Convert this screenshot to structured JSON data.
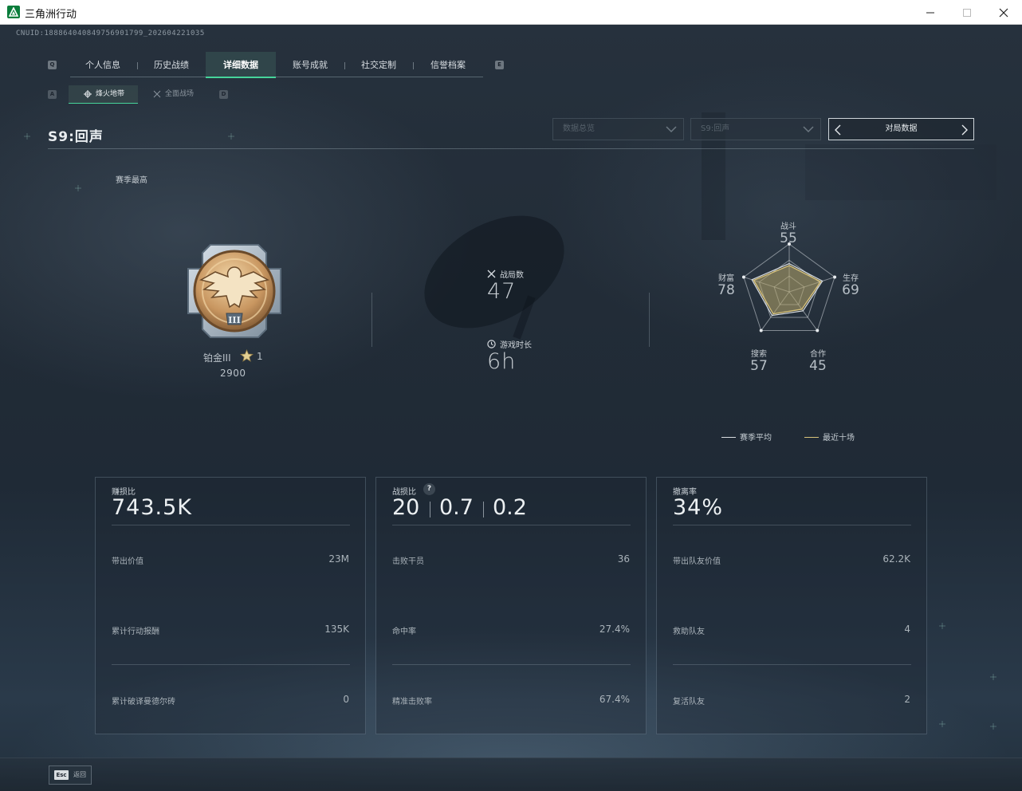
{
  "window": {
    "title": "三角洲行动"
  },
  "uid": "CNUID:1888640408497569017​99_202604221035",
  "nav": {
    "left_key": "Q",
    "right_key": "E",
    "tabs": [
      {
        "label": "个人信息",
        "active": false
      },
      {
        "label": "历史战绩",
        "active": false
      },
      {
        "label": "详细数据",
        "active": true
      },
      {
        "label": "账号成就",
        "active": false
      },
      {
        "label": "社交定制",
        "active": false
      },
      {
        "label": "信誉档案",
        "active": false
      }
    ]
  },
  "subnav": {
    "left_key": "A",
    "right_key": "D",
    "tabs": [
      {
        "label": "烽火地带",
        "active": true
      },
      {
        "label": "全面战场",
        "active": false
      }
    ]
  },
  "season_title": "S9:回声",
  "filters": {
    "data_scope": "数据总览",
    "season": "S9:回声",
    "match_data_button": "对局数据"
  },
  "rank": {
    "section_label": "赛季最高",
    "tier": "铂金III",
    "stars": "1",
    "score": "2900",
    "badge_icon": "platinum-eagle-badge-icon",
    "badge_numeral": "III"
  },
  "overview": {
    "matches_label": "战局数",
    "matches_value": "47",
    "playtime_label": "游戏时长",
    "playtime_value": "6h"
  },
  "radar": {
    "axes": [
      {
        "label": "战斗",
        "value": 55
      },
      {
        "label": "生存",
        "value": 69
      },
      {
        "label": "合作",
        "value": 45
      },
      {
        "label": "搜索",
        "value": 57
      },
      {
        "label": "财富",
        "value": 78
      }
    ],
    "legend": {
      "season_avg": "赛季平均",
      "recent_ten": "最近十场"
    },
    "colors": {
      "season_avg": "#d9dde0",
      "recent_ten": "#d8c27a",
      "fill": "#b7a66a"
    }
  },
  "cards": [
    {
      "title": "赚损比",
      "big_value": "743.5K",
      "rows": [
        {
          "label": "带出价值",
          "value": "23M"
        },
        {
          "label": "累计行动报酬",
          "value": "135K"
        },
        {
          "label": "累计破译曼德尔砖",
          "value": "0"
        }
      ]
    },
    {
      "title": "战损比",
      "help": "?",
      "kd_values": [
        "20",
        "0.7",
        "0.2"
      ],
      "rows": [
        {
          "label": "击败干员",
          "value": "36"
        },
        {
          "label": "命中率",
          "value": "27.4%"
        },
        {
          "label": "精准击败率",
          "value": "67.4%"
        }
      ]
    },
    {
      "title": "撤离率",
      "big_value": "34%",
      "rows": [
        {
          "label": "带出队友价值",
          "value": "62.2K"
        },
        {
          "label": "救助队友",
          "value": "4"
        },
        {
          "label": "复活队友",
          "value": "2"
        }
      ]
    }
  ],
  "footer": {
    "esc_key": "Esc",
    "back_label": "返回"
  }
}
